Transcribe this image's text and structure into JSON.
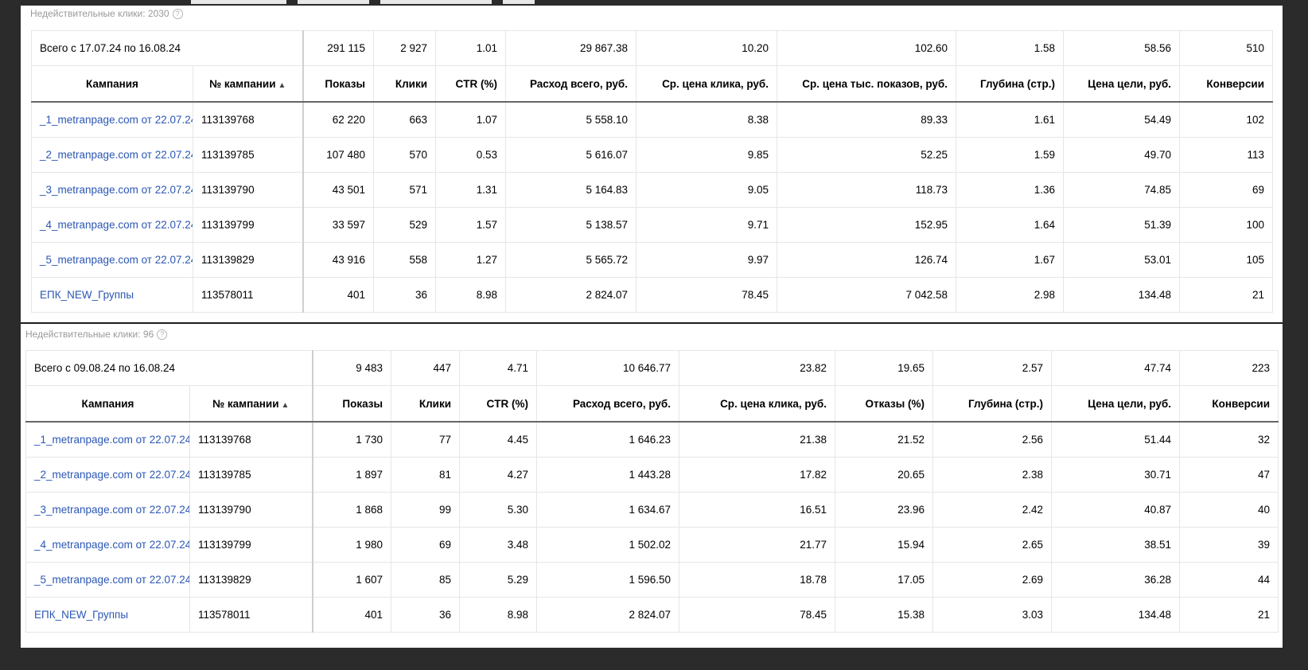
{
  "panel1": {
    "invalid_clicks_label": "Недействительные клики: 2030",
    "total": {
      "label": "Всего с 17.07.24 по 16.08.24",
      "values": [
        "291 115",
        "2 927",
        "1.01",
        "29 867.38",
        "10.20",
        "102.60",
        "1.58",
        "58.56",
        "510"
      ]
    },
    "headers": [
      "Кампания",
      "№ кампании",
      "Показы",
      "Клики",
      "CTR (%)",
      "Расход всего, руб.",
      "Ср. цена клика, руб.",
      "Ср. цена тыс. показов, руб.",
      "Глубина (стр.)",
      "Цена цели, руб.",
      "Конверсии"
    ],
    "sort_indicator": "▲",
    "rows": [
      [
        "_1_metranpage.com от 22.07.24",
        "113139768",
        "62 220",
        "663",
        "1.07",
        "5 558.10",
        "8.38",
        "89.33",
        "1.61",
        "54.49",
        "102"
      ],
      [
        "_2_metranpage.com от 22.07.24",
        "113139785",
        "107 480",
        "570",
        "0.53",
        "5 616.07",
        "9.85",
        "52.25",
        "1.59",
        "49.70",
        "113"
      ],
      [
        "_3_metranpage.com от 22.07.24",
        "113139790",
        "43 501",
        "571",
        "1.31",
        "5 164.83",
        "9.05",
        "118.73",
        "1.36",
        "74.85",
        "69"
      ],
      [
        "_4_metranpage.com от 22.07.24",
        "113139799",
        "33 597",
        "529",
        "1.57",
        "5 138.57",
        "9.71",
        "152.95",
        "1.64",
        "51.39",
        "100"
      ],
      [
        "_5_metranpage.com от 22.07.24",
        "113139829",
        "43 916",
        "558",
        "1.27",
        "5 565.72",
        "9.97",
        "126.74",
        "1.67",
        "53.01",
        "105"
      ],
      [
        "ЕПК_NEW_Группы",
        "113578011",
        "401",
        "36",
        "8.98",
        "2 824.07",
        "78.45",
        "7 042.58",
        "2.98",
        "134.48",
        "21"
      ]
    ]
  },
  "panel2": {
    "invalid_clicks_label": "Недействительные клики: 96",
    "total": {
      "label": "Всего с 09.08.24 по 16.08.24",
      "values": [
        "9 483",
        "447",
        "4.71",
        "10 646.77",
        "23.82",
        "19.65",
        "2.57",
        "47.74",
        "223"
      ]
    },
    "headers": [
      "Кампания",
      "№ кампании",
      "Показы",
      "Клики",
      "CTR (%)",
      "Расход всего, руб.",
      "Ср. цена клика, руб.",
      "Отказы (%)",
      "Глубина (стр.)",
      "Цена цели, руб.",
      "Конверсии"
    ],
    "sort_indicator": "▲",
    "rows": [
      [
        "_1_metranpage.com от 22.07.24",
        "113139768",
        "1 730",
        "77",
        "4.45",
        "1 646.23",
        "21.38",
        "21.52",
        "2.56",
        "51.44",
        "32"
      ],
      [
        "_2_metranpage.com от 22.07.24",
        "113139785",
        "1 897",
        "81",
        "4.27",
        "1 443.28",
        "17.82",
        "20.65",
        "2.38",
        "30.71",
        "47"
      ],
      [
        "_3_metranpage.com от 22.07.24",
        "113139790",
        "1 868",
        "99",
        "5.30",
        "1 634.67",
        "16.51",
        "23.96",
        "2.42",
        "40.87",
        "40"
      ],
      [
        "_4_metranpage.com от 22.07.24",
        "113139799",
        "1 980",
        "69",
        "3.48",
        "1 502.02",
        "21.77",
        "15.94",
        "2.65",
        "38.51",
        "39"
      ],
      [
        "_5_metranpage.com от 22.07.24",
        "113139829",
        "1 607",
        "85",
        "5.29",
        "1 596.50",
        "18.78",
        "17.05",
        "2.69",
        "36.28",
        "44"
      ],
      [
        "ЕПК_NEW_Группы",
        "113578011",
        "401",
        "36",
        "8.98",
        "2 824.07",
        "78.45",
        "15.38",
        "3.03",
        "134.48",
        "21"
      ]
    ]
  }
}
